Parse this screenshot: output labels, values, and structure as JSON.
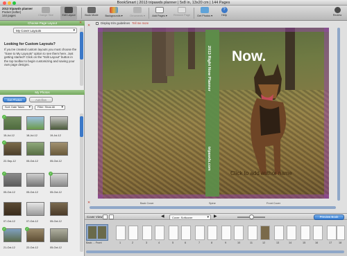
{
  "window": {
    "title": "BookSmart | 2013 tripawds planner | 5x8 in, 13x20 cm | 144 Pages"
  },
  "project": {
    "name": "2013 tripawds planner",
    "type": "Pocket (softer)",
    "pages": "144 pages"
  },
  "toolbar": {
    "change_size": "Change Size",
    "edit_layout": "Edit Layout",
    "book_mode": "Book Mode",
    "backgrounds": "Backgrounds ▾",
    "ornaments": "Ornaments ▾",
    "add_pages": "Add Pages ▾",
    "remove_page": "Remove Page",
    "get_photos": "Get Photos ▾",
    "help": "Help",
    "review": "Review"
  },
  "sidebar": {
    "choose_layout_header": "Choose Page Layout",
    "layout_select": "My Cover Layouts",
    "tip_title": "Looking for Custom Layouts?",
    "tip_body": "If you've created custom layouts you must choose the \"Save to My Layouts\" option to see them here. Just getting started? Click on the \"Edit Layout\" button in the top toolbar to begin customizing and saving your own page designs.",
    "my_photos_header": "My Photos",
    "get_photos_button": "Get Photos",
    "autoflow_button": "Autoflow",
    "sort_select": "Sort: Date Taken",
    "filter_select": "Filter: Show All",
    "photos": [
      {
        "date": "15-Jul-12",
        "used": true
      },
      {
        "date": "18-Jul-12",
        "used": false
      },
      {
        "date": "19-Jul-12",
        "used": false
      },
      {
        "date": "22-Sep-12",
        "used": true
      },
      {
        "date": "05-Oct-12",
        "used": false
      },
      {
        "date": "05-Oct-12",
        "used": false
      },
      {
        "date": "05-Oct-12",
        "used": true
      },
      {
        "date": "05-Oct-12",
        "used": false
      },
      {
        "date": "05-Oct-12",
        "used": true
      },
      {
        "date": "07-Oct-12",
        "used": false
      },
      {
        "date": "07-Oct-12",
        "used": false
      },
      {
        "date": "05-Oct-12",
        "used": false
      },
      {
        "date": "21-Oct-12",
        "used": false
      },
      {
        "date": "22-Oct-12",
        "used": false
      },
      {
        "date": "05-Oct-12",
        "used": false
      }
    ]
  },
  "canvas": {
    "display_guidelines": "Display trim guidelines",
    "guidelines_link": "Tell me more",
    "spine_title": "2013 Right Now Planner",
    "spine_url": "tripawds.com",
    "cover_headline": "Now.",
    "author_placeholder": "Click to add author name",
    "back_cover_label": "Back Cover",
    "spine_label": "Spine",
    "front_cover_label": "Front Cover"
  },
  "cover_view": {
    "label": "Cover View",
    "select": "Cover, Softcover",
    "preview_button": "Preview Book"
  },
  "page_strip": {
    "first_label": "Back ... Front",
    "page_numbers": [
      "1",
      "2",
      "3",
      "4",
      "5",
      "6",
      "7",
      "8",
      "9",
      "10",
      "11",
      "12",
      "13",
      "14",
      "15",
      "16",
      "17",
      "18"
    ]
  },
  "colors": {
    "panel_green": "#73a75e",
    "accent_blue": "#2f78d0",
    "bleed_purple": "#9646aa",
    "spine_green": "#5d8d4a"
  }
}
